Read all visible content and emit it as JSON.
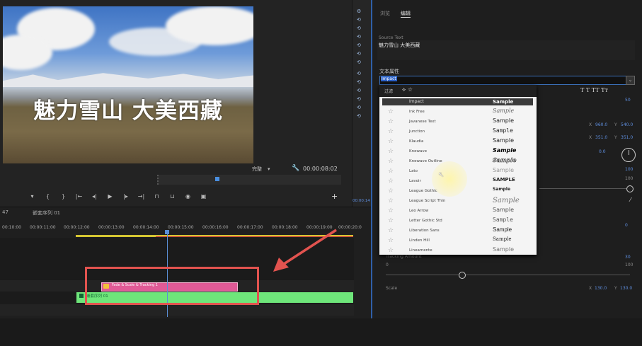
{
  "monitor": {
    "overlay_text": "魅力雪山 大美西藏",
    "quality": "完整",
    "timecode": "00:00:08:02",
    "controls": [
      "marker",
      "in",
      "out",
      "goto-in",
      "step-back",
      "play",
      "step-forward",
      "goto-out",
      "lift",
      "extract",
      "export-frame",
      "compare"
    ]
  },
  "timeline": {
    "tab_number": "47",
    "sequence_title": "嵌套序列 01",
    "ruler": [
      "00:10:00",
      "00:00:11:00",
      "00:00:12:00",
      "00:00:13:00",
      "00:00:14:00",
      "00:00:15:00",
      "00:00:16:00",
      "00:00:17:00",
      "00:00:18:00",
      "00:00:19:00",
      "00:00:20:0"
    ],
    "clip_graphic": "Fade & Scale & Tracking 1",
    "clip_sequence": "嵌套序列 01"
  },
  "panel": {
    "tab_browse": "浏览",
    "tab_edit": "编辑",
    "source_text_label": "Source Text",
    "source_text_value": "魅力雪山 大美西藏",
    "text_props_label": "文本属性",
    "font_value": "Impact",
    "style_buttons": "T T TT Tт",
    "size_value": "50",
    "pos_x_label": "X",
    "pos_x": "960.0",
    "pos_y_label": "Y",
    "pos_y": "540.0",
    "anchor_x_label": "X",
    "anchor_x": "351.0",
    "anchor_y_label": "Y",
    "anchor_y": "351.0",
    "rotation": "0.0",
    "opacity": "100",
    "opacity_max": "100",
    "val_0": "0",
    "tracking_label": "Tracking Amount",
    "tracking_val": "30",
    "tracking_min": "0",
    "tracking_max": "100",
    "scale_label": "Scale",
    "scale_x_label": "X",
    "scale_x": "130.0",
    "scale_y_label": "Y",
    "scale_y": "130.0",
    "strip_time": "00:00:14"
  },
  "dropdown": {
    "filter_label": "过滤",
    "header_name": "Impact",
    "header_sample": "Sample",
    "fonts": [
      {
        "name": "Ink Free",
        "sample": "Sample"
      },
      {
        "name": "Javanese Text",
        "sample": "Sample"
      },
      {
        "name": "Junction",
        "sample": "Sample"
      },
      {
        "name": "Klaudia",
        "sample": "Sample"
      },
      {
        "name": "Knewave",
        "sample": "Sample"
      },
      {
        "name": "Knewave Outline",
        "sample": "Sample"
      },
      {
        "name": "Lato",
        "sample": "Sample"
      },
      {
        "name": "Lavoir",
        "sample": "SAMPLE"
      },
      {
        "name": "League Gothic",
        "sample": "Sample"
      },
      {
        "name": "League Script Thin",
        "sample": "Sample"
      },
      {
        "name": "Leo Arrow",
        "sample": "Sample"
      },
      {
        "name": "Letter Gothic Std",
        "sample": "Sample"
      },
      {
        "name": "Liberation Sans",
        "sample": "Sample"
      },
      {
        "name": "Linden Hill",
        "sample": "Sample"
      },
      {
        "name": "Lineamente",
        "sample": "Sample"
      }
    ]
  },
  "colors": {
    "accent_blue": "#5f8fe0",
    "clip_pink": "#e05a96",
    "clip_green": "#6ee67a",
    "annotation_red": "#e2534f"
  }
}
